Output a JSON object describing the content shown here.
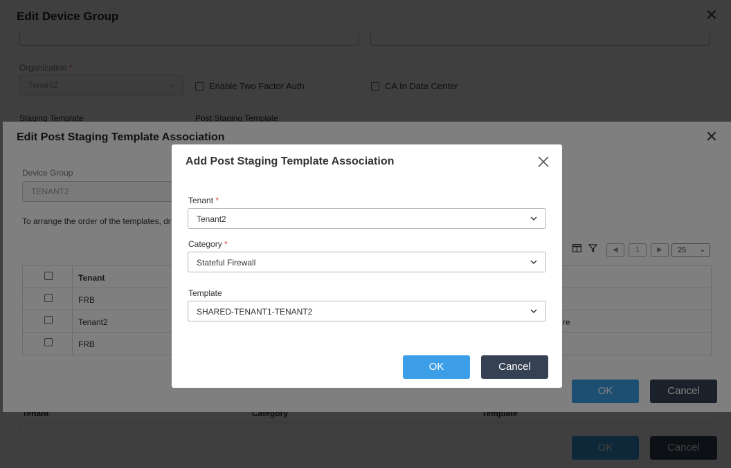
{
  "device_group_dialog": {
    "title": "Edit Device Group",
    "organization_label": "Organization",
    "organization_value": "Tenant2",
    "two_factor_label": "Enable Two Factor Auth",
    "ca_label": "CA In Data Center",
    "staging_template_label": "Staging Template",
    "post_staging_template_label": "Post Staging Template",
    "table_headers": [
      "Tenant",
      "Category",
      "Template"
    ],
    "ok_label": "OK",
    "cancel_label": "Cancel"
  },
  "post_staging_dialog": {
    "title": "Edit Post Staging Template Association",
    "device_group_label": "Device Group",
    "device_group_value": "TENANT2",
    "hint": "To arrange the order of the templates, dr",
    "page_number": "1",
    "page_size": "25",
    "table_header": "Tenant",
    "rows": [
      {
        "tenant": "FRB",
        "right_text": ""
      },
      {
        "tenant": "Tenant2",
        "right_text": "re"
      },
      {
        "tenant": "FRB",
        "right_text": ""
      }
    ],
    "ok_label": "OK",
    "cancel_label": "Cancel"
  },
  "add_dialog": {
    "title": "Add Post Staging Template Association",
    "tenant_label": "Tenant",
    "tenant_value": "Tenant2",
    "category_label": "Category",
    "category_value": "Stateful Firewall",
    "template_label": "Template",
    "template_value": "SHARED-TENANT1-TENANT2",
    "ok_label": "OK",
    "cancel_label": "Cancel"
  },
  "colors": {
    "ok_button": "#3b9ee6",
    "cancel_button": "#364254",
    "required": "#e04141"
  }
}
